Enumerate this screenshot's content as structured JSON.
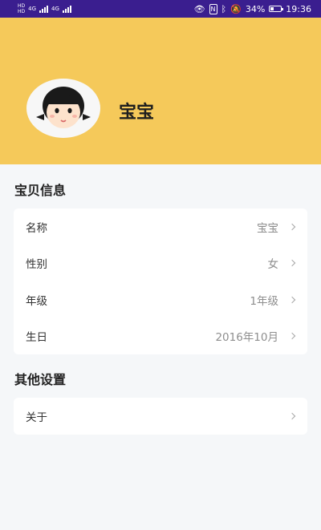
{
  "status_bar": {
    "hd1": "HD",
    "hd2": "HD",
    "net1": "4G",
    "net2": "4G",
    "battery_percent": "34%",
    "time": "19:36",
    "battery_level": 0.34
  },
  "profile": {
    "name": "宝宝"
  },
  "sections": {
    "baby_info": {
      "title": "宝贝信息",
      "rows": [
        {
          "label": "名称",
          "value": "宝宝"
        },
        {
          "label": "性别",
          "value": "女"
        },
        {
          "label": "年级",
          "value": "1年级"
        },
        {
          "label": "生日",
          "value": "2016年10月"
        }
      ]
    },
    "other_settings": {
      "title": "其他设置",
      "rows": [
        {
          "label": "关于"
        }
      ]
    }
  },
  "colors": {
    "status_bar_bg": "#3a1e8f",
    "header_bg": "#f5c95a",
    "page_bg": "#f5f7f9"
  }
}
